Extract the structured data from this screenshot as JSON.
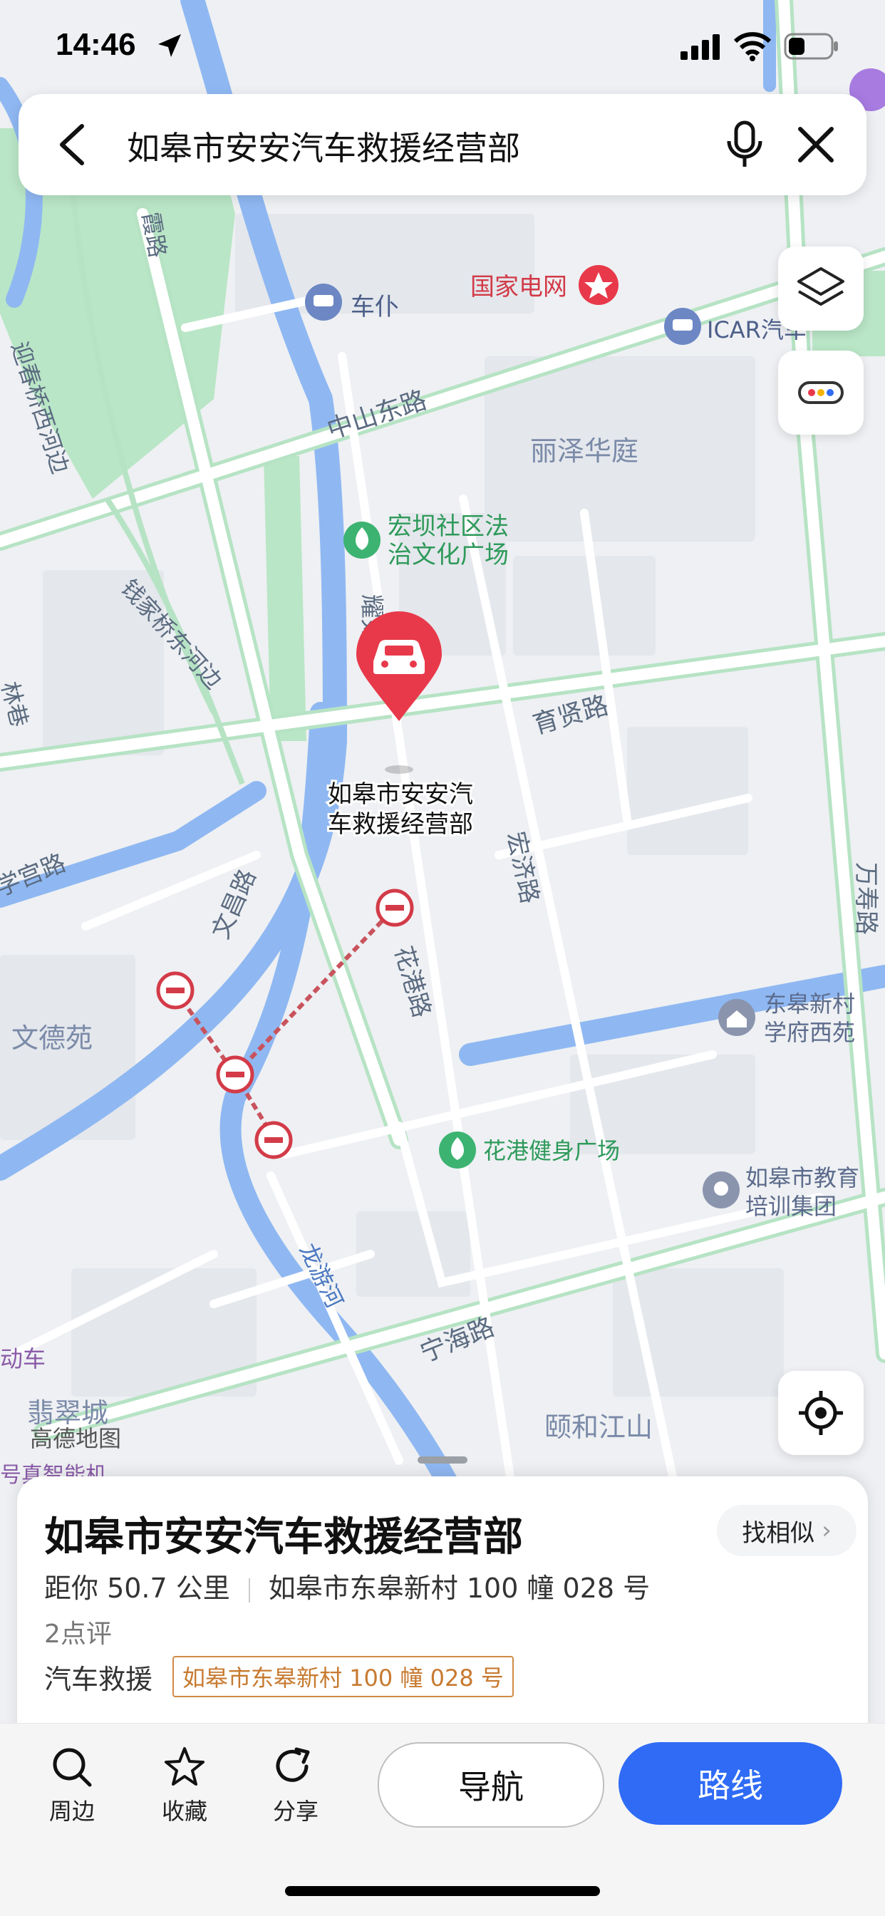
{
  "status": {
    "time": "14:46"
  },
  "search": {
    "query": "如皋市安安汽车救援经营部"
  },
  "map": {
    "roads": [
      "霞路",
      "中山东路",
      "迎春桥西河边",
      "钱家桥东河边",
      "耀如南",
      "育贤路",
      "学宫路",
      "文昌路",
      "宏济路",
      "花港路",
      "万寿路",
      "龙游河",
      "宁海路",
      "林巷"
    ],
    "pois": [
      "车仆",
      "国家电网",
      "ICAR汽车",
      "丽泽华庭",
      "宏坝社区法治文化广场",
      "东皋新村学府西苑",
      "文德苑",
      "花港健身广场",
      "如皋市教育培训集团",
      "颐和江山",
      "翡翠城",
      "动车"
    ],
    "marker_label_line1": "如皋市安安汽",
    "marker_label_line2": "车救援经营部",
    "brand": "高德地图",
    "partial_bottom_label": "号真智能机"
  },
  "place": {
    "name": "如皋市安安汽车救援经营部",
    "distance": "距你 50.7 公里",
    "address": "如皋市东皋新村 100 幢 028 号",
    "rating": "2点评",
    "category": "汽车救援",
    "tag": "如皋市东皋新村 100 幢 028 号",
    "similar_label": "找相似"
  },
  "toolbar": {
    "nearby": "周边",
    "favorite": "收藏",
    "share": "分享",
    "navigate": "导航",
    "route": "路线"
  },
  "colors": {
    "accent": "#2f6bf5",
    "marker": "#e8394a",
    "water": "#8fb8f2",
    "green": "#a8dfb8"
  }
}
